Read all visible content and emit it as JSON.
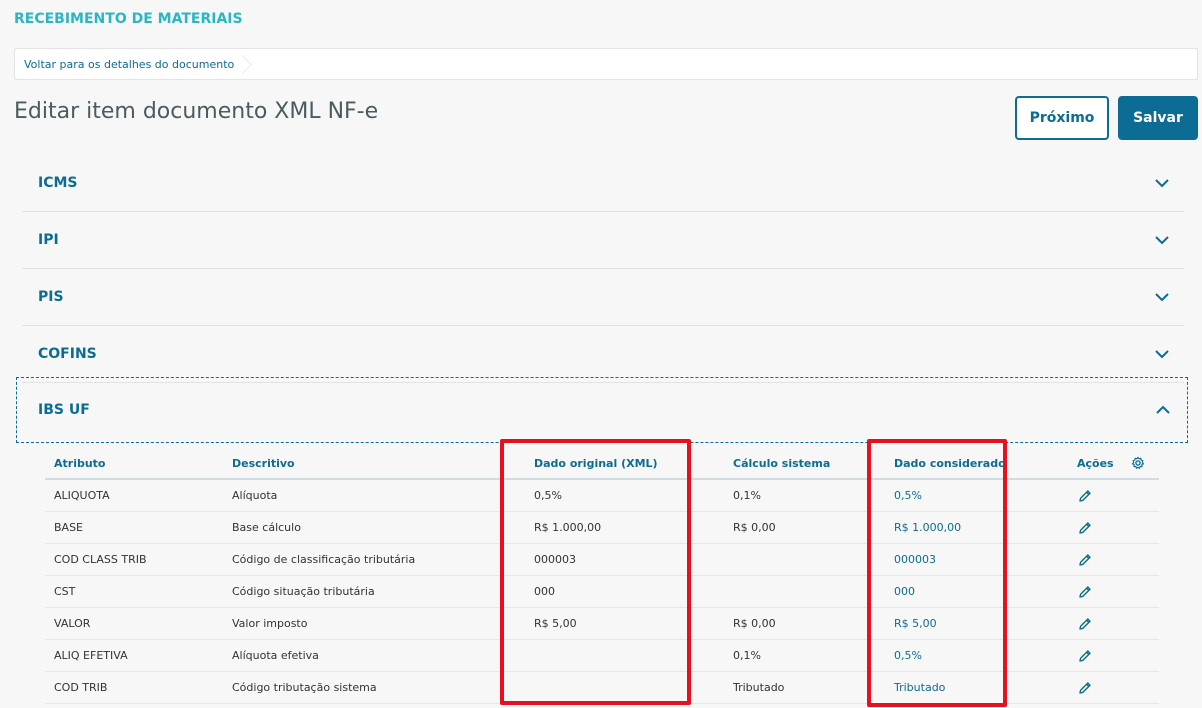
{
  "app": {
    "title": "RECEBIMENTO DE MATERIAIS"
  },
  "breadcrumb": {
    "back_link": "Voltar para os detalhes do documento"
  },
  "page": {
    "title": "Editar item documento XML NF-e"
  },
  "actions": {
    "next_label": "Próximo",
    "save_label": "Salvar"
  },
  "sections": [
    {
      "label": "ICMS",
      "expanded": false
    },
    {
      "label": "IPI",
      "expanded": false
    },
    {
      "label": "PIS",
      "expanded": false
    },
    {
      "label": "COFINS",
      "expanded": false
    },
    {
      "label": "IBS UF",
      "expanded": true
    }
  ],
  "table": {
    "headers": [
      "Atributo",
      "Descritivo",
      "Dado original (XML)",
      "Cálculo sistema",
      "Dado considerado",
      "Ações"
    ],
    "rows": [
      {
        "atributo": "ALIQUOTA",
        "descritivo": "Alíquota",
        "original": "0,5%",
        "calculo": "0,1%",
        "considerado": "0,5%"
      },
      {
        "atributo": "BASE",
        "descritivo": "Base cálculo",
        "original": "R$ 1.000,00",
        "calculo": "R$ 0,00",
        "considerado": "R$ 1.000,00"
      },
      {
        "atributo": "COD CLASS TRIB",
        "descritivo": "Código de classificação tributária",
        "original": "000003",
        "calculo": "",
        "considerado": "000003"
      },
      {
        "atributo": "CST",
        "descritivo": "Código situação tributária",
        "original": "000",
        "calculo": "",
        "considerado": "000"
      },
      {
        "atributo": "VALOR",
        "descritivo": "Valor imposto",
        "original": "R$ 5,00",
        "calculo": "R$ 0,00",
        "considerado": "R$ 5,00"
      },
      {
        "atributo": "ALIQ EFETIVA",
        "descritivo": "Alíquota efetiva",
        "original": "",
        "calculo": "0,1%",
        "considerado": "0,5%"
      },
      {
        "atributo": "COD TRIB",
        "descritivo": "Código tributação sistema",
        "original": "",
        "calculo": "Tributado",
        "considerado": "Tributado"
      }
    ]
  },
  "colors": {
    "primary": "#0c6c94",
    "accent": "#29b6c5",
    "highlight": "#e8101c"
  },
  "icons": {
    "expand": "chevron-down-icon",
    "collapse": "chevron-up-icon",
    "edit": "pencil-icon",
    "settings": "gear-icon"
  }
}
